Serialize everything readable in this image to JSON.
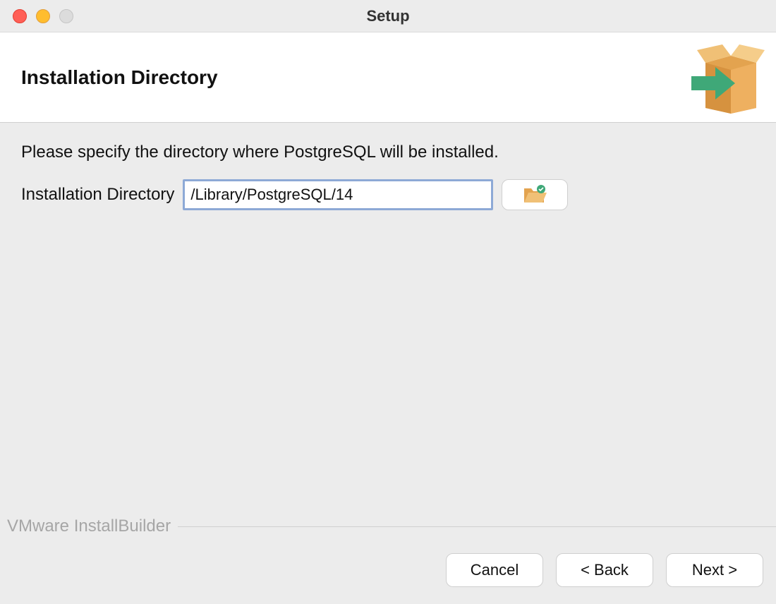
{
  "window": {
    "title": "Setup"
  },
  "header": {
    "title": "Installation Directory"
  },
  "body": {
    "instructions": "Please specify the directory where PostgreSQL will be installed.",
    "field_label": "Installation Directory",
    "field_value": "/Library/PostgreSQL/14"
  },
  "footer": {
    "brand": "VMware InstallBuilder",
    "buttons": {
      "cancel": "Cancel",
      "back": "< Back",
      "next": "Next >"
    }
  }
}
